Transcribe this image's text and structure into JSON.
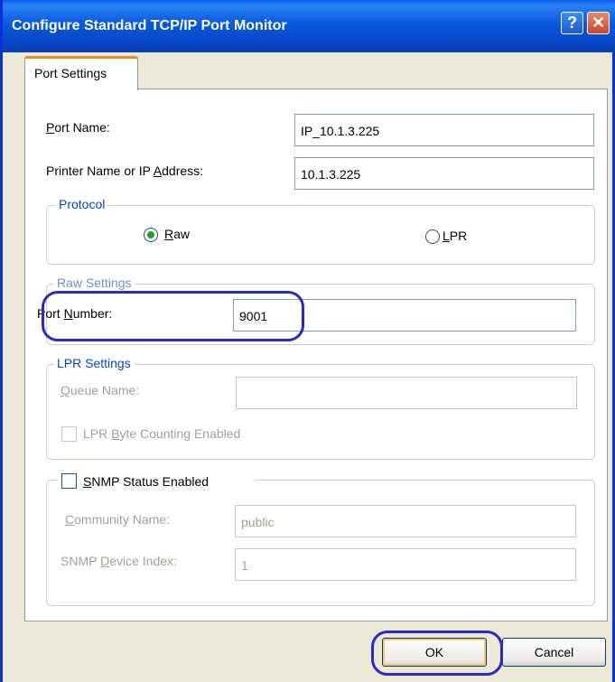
{
  "window": {
    "title": "Configure Standard TCP/IP Port Monitor",
    "help_glyph": "?",
    "close_glyph": "✕"
  },
  "tab": {
    "label": "Port Settings"
  },
  "port_name": {
    "label": "Port Name:",
    "value": "IP_10.1.3.225"
  },
  "printer_address": {
    "label": "Printer Name or IP Address:",
    "value": "10.1.3.225"
  },
  "protocol": {
    "title": "Protocol",
    "options": [
      {
        "label": "Raw",
        "selected": true
      },
      {
        "label": "LPR",
        "selected": false
      }
    ]
  },
  "raw_settings": {
    "title": "Raw Settings",
    "port_number_label": "Port Number:",
    "port_number_value": "9001"
  },
  "lpr_settings": {
    "title": "LPR Settings",
    "queue_name_label": "Queue Name:",
    "queue_name_value": "",
    "byte_counting_label": "LPR Byte Counting Enabled",
    "byte_counting_checked": false
  },
  "snmp": {
    "status_label": "SNMP Status Enabled",
    "status_checked": false,
    "community_label": "Community Name:",
    "community_value": "public",
    "device_index_label": "SNMP Device Index:",
    "device_index_value": "1"
  },
  "buttons": {
    "ok": "OK",
    "cancel": "Cancel"
  },
  "colors": {
    "titlebar": "#0A5EE8",
    "dialog_bg": "#ECE9D8",
    "group_title": "#0046D5",
    "annotation": "#2929C8",
    "radio_selected": "#21A121"
  }
}
